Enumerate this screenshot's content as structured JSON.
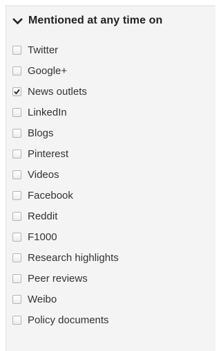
{
  "filter": {
    "title": "Mentioned at any time on",
    "toggle_icon": "chevron-down-icon",
    "options": [
      {
        "label": "Twitter",
        "checked": false
      },
      {
        "label": "Google+",
        "checked": false
      },
      {
        "label": "News outlets",
        "checked": true
      },
      {
        "label": "LinkedIn",
        "checked": false
      },
      {
        "label": "Blogs",
        "checked": false
      },
      {
        "label": "Pinterest",
        "checked": false
      },
      {
        "label": "Videos",
        "checked": false
      },
      {
        "label": "Facebook",
        "checked": false
      },
      {
        "label": "Reddit",
        "checked": false
      },
      {
        "label": "F1000",
        "checked": false
      },
      {
        "label": "Research highlights",
        "checked": false
      },
      {
        "label": "Peer reviews",
        "checked": false
      },
      {
        "label": "Weibo",
        "checked": false
      },
      {
        "label": "Policy documents",
        "checked": false
      }
    ]
  }
}
